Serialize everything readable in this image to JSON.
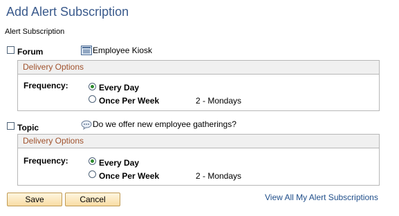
{
  "page": {
    "title": "Add Alert Subscription",
    "section_label": "Alert Subscription"
  },
  "forum": {
    "label": "Forum",
    "checked": false,
    "icon": "forum-icon",
    "name": "Employee Kiosk",
    "delivery": {
      "header": "Delivery Options",
      "frequency_label": "Frequency:",
      "options": [
        {
          "label": "Every Day",
          "selected": true
        },
        {
          "label": "Once Per Week",
          "selected": false
        }
      ],
      "weekly_day": "2 - Mondays"
    }
  },
  "topic": {
    "label": "Topic",
    "checked": false,
    "icon": "discussion-bubble-icon",
    "name": "Do we offer new employee gatherings?",
    "delivery": {
      "header": "Delivery Options",
      "frequency_label": "Frequency:",
      "options": [
        {
          "label": "Every Day",
          "selected": true
        },
        {
          "label": "Once Per Week",
          "selected": false
        }
      ],
      "weekly_day": "2 - Mondays"
    }
  },
  "actions": {
    "save_label": "Save",
    "cancel_label": "Cancel",
    "view_all_link": "View All My Alert Subscriptions"
  },
  "colors": {
    "title": "#3a5a8c",
    "delivery_header_text": "#a0522d",
    "radio_selected": "#2d8a2d",
    "link": "#1f4e8a",
    "button_border": "#c09a52"
  }
}
